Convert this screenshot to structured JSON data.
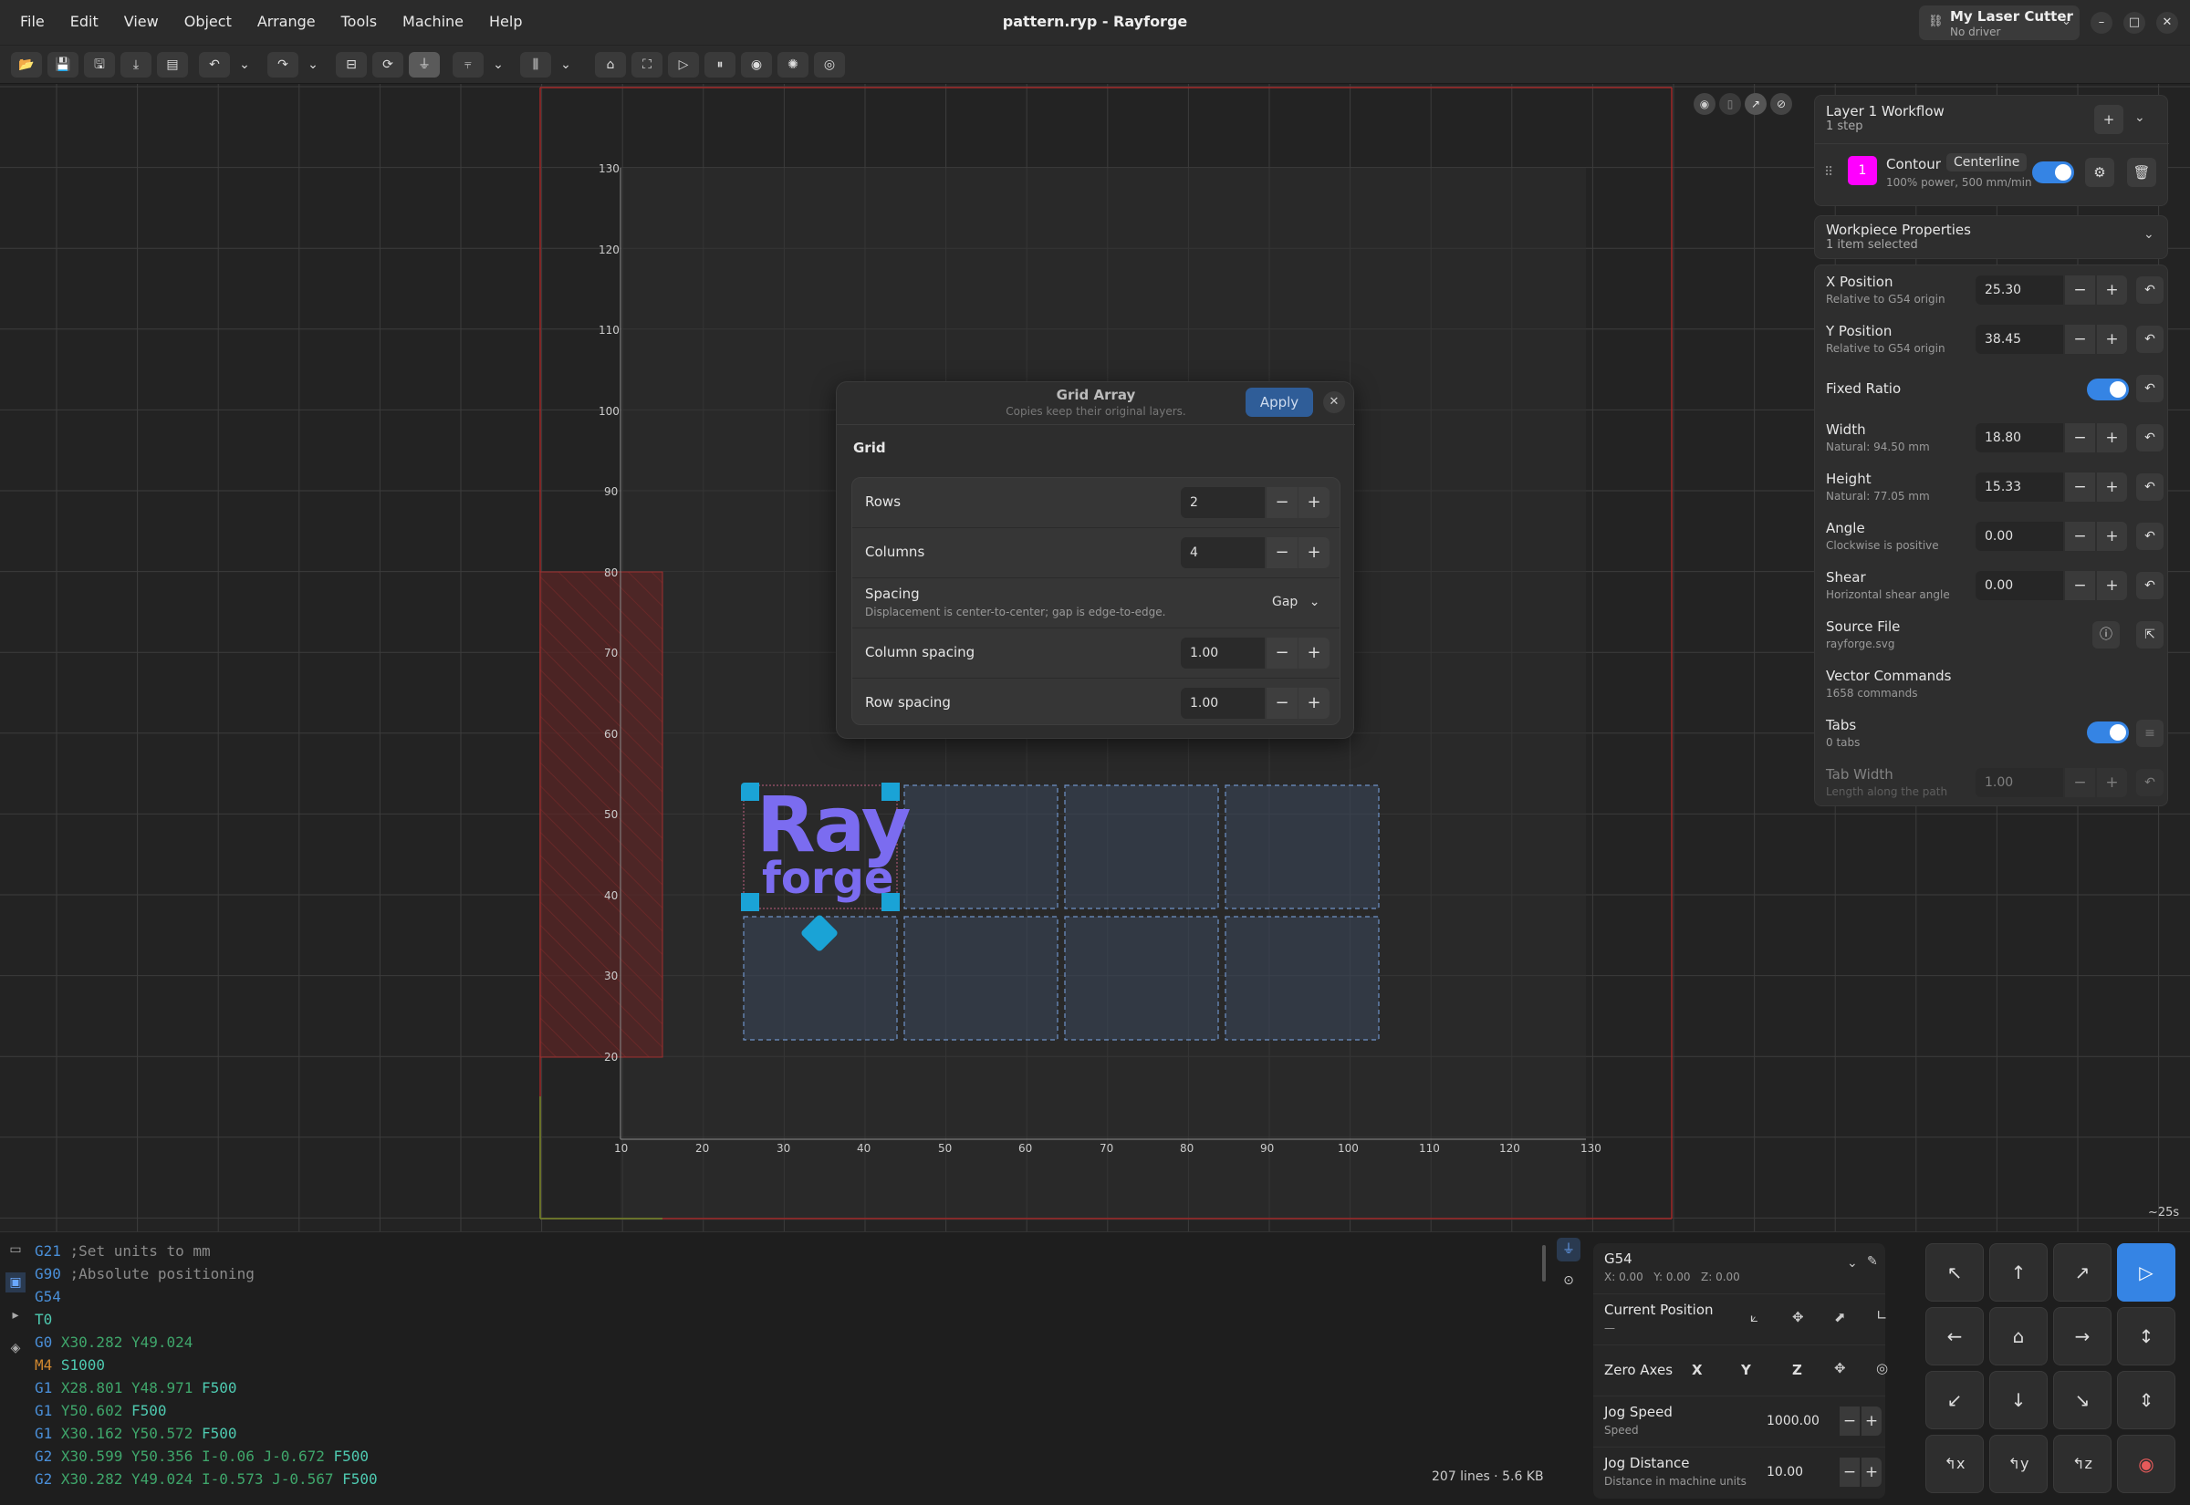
{
  "menu": [
    "File",
    "Edit",
    "View",
    "Object",
    "Arrange",
    "Tools",
    "Machine",
    "Help"
  ],
  "window_title": "pattern.ryp - Rayforge",
  "machine": {
    "name": "My Laser Cutter",
    "status": "No driver"
  },
  "canvas": {
    "x_ticks": [
      "10",
      "20",
      "30",
      "40",
      "50",
      "60",
      "70",
      "80",
      "90",
      "100",
      "110",
      "120",
      "130"
    ],
    "y_ticks": [
      "130",
      "120",
      "110",
      "100",
      "90",
      "80",
      "70",
      "60",
      "50",
      "40",
      "30",
      "20"
    ],
    "logo_line1": "Ray",
    "logo_line2": "forge",
    "eta": "~25s"
  },
  "dialog": {
    "title": "Grid Array",
    "subtitle": "Copies keep their original layers.",
    "apply_label": "Apply",
    "group_label": "Grid",
    "rows_label": "Rows",
    "rows_value": "2",
    "columns_label": "Columns",
    "columns_value": "4",
    "spacing_label": "Spacing",
    "spacing_desc": "Displacement is center-to-center; gap is edge-to-edge.",
    "spacing_value": "Gap",
    "col_spacing_label": "Column spacing",
    "col_spacing_value": "1.00",
    "row_spacing_label": "Row spacing",
    "row_spacing_value": "1.00"
  },
  "workflow": {
    "title": "Layer 1 Workflow",
    "subtitle": "1 step",
    "step_number": "1",
    "step_name": "Contour",
    "step_mode": "Centerline",
    "step_desc": "100% power, 500 mm/min"
  },
  "workpiece": {
    "title": "Workpiece Properties",
    "subtitle": "1 item selected",
    "x_label": "X Position",
    "x_sub": "Relative to G54 origin",
    "x_value": "25.30",
    "y_label": "Y Position",
    "y_sub": "Relative to G54 origin",
    "y_value": "38.45",
    "ratio_label": "Fixed Ratio",
    "width_label": "Width",
    "width_sub": "Natural: 94.50 mm",
    "width_value": "18.80",
    "height_label": "Height",
    "height_sub": "Natural: 77.05 mm",
    "height_value": "15.33",
    "angle_label": "Angle",
    "angle_sub": "Clockwise is positive",
    "angle_value": "0.00",
    "shear_label": "Shear",
    "shear_sub": "Horizontal shear angle",
    "shear_value": "0.00",
    "source_label": "Source File",
    "source_value": "rayforge.svg",
    "vector_label": "Vector Commands",
    "vector_value": "1658 commands",
    "tabs_label": "Tabs",
    "tabs_value": "0 tabs",
    "tabw_label": "Tab Width",
    "tabw_sub": "Length along the path",
    "tabw_value": "1.00"
  },
  "gcode": {
    "lines": [
      [
        [
          "G21",
          "#4a8fd8"
        ],
        [
          " ;Set units to mm",
          "#8a8a8a"
        ]
      ],
      [
        [
          "G90",
          "#4a8fd8"
        ],
        [
          " ;Absolute positioning",
          "#8a8a8a"
        ]
      ],
      [
        [
          "G54",
          "#4a8fd8"
        ]
      ],
      [
        [
          "T0",
          "#4ec9b0"
        ]
      ],
      [
        [
          "G0",
          "#4a8fd8"
        ],
        [
          " X30.282 Y49.024",
          "#3fa66b"
        ]
      ],
      [
        [
          "M4",
          "#d2892f"
        ],
        [
          " S1000",
          "#4ec9b0"
        ]
      ],
      [
        [
          "G1",
          "#4a8fd8"
        ],
        [
          " X28.801 Y48.971",
          "#3fa66b"
        ],
        [
          " F500",
          "#4ec9b0"
        ]
      ],
      [
        [
          "G1",
          "#4a8fd8"
        ],
        [
          " Y50.602",
          "#3fa66b"
        ],
        [
          " F500",
          "#4ec9b0"
        ]
      ],
      [
        [
          "G1",
          "#4a8fd8"
        ],
        [
          " X30.162 Y50.572",
          "#3fa66b"
        ],
        [
          " F500",
          "#4ec9b0"
        ]
      ],
      [
        [
          "G2",
          "#4a8fd8"
        ],
        [
          " X30.599 Y50.356 I-0.06 J-0.672",
          "#3fa66b"
        ],
        [
          " F500",
          "#4ec9b0"
        ]
      ],
      [
        [
          "G2",
          "#4a8fd8"
        ],
        [
          " X30.282 Y49.024 I-0.573 J-0.567",
          "#3fa66b"
        ],
        [
          " F500",
          "#4ec9b0"
        ]
      ]
    ],
    "stats": "207 lines · 5.6 KB"
  },
  "machine_panel": {
    "wcs": "G54",
    "wcs_coords": "X: 0.00   Y: 0.00   Z: 0.00",
    "current_pos_label": "Current Position",
    "current_pos_value": "—",
    "zero_axes_label": "Zero Axes",
    "axis_x": "X",
    "axis_y": "Y",
    "axis_z": "Z",
    "jog_speed_label": "Jog Speed",
    "jog_speed_sub": "Speed",
    "jog_speed_value": "1000.00",
    "jog_dist_label": "Jog Distance",
    "jog_dist_sub": "Distance in machine units",
    "jog_dist_value": "10.00"
  },
  "colors": {
    "accent": "#3584e4",
    "magenta": "#ff00ff",
    "selection": "#1aa3d6",
    "logo": "#7b6cf0"
  }
}
